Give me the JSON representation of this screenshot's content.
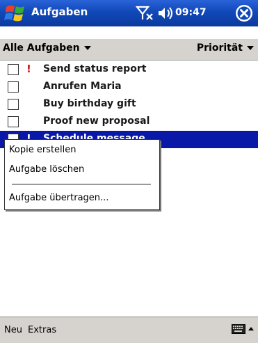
{
  "title_bar": {
    "app_title": "Aufgaben",
    "time": "09:47",
    "background": "#1148b8"
  },
  "filter_bar": {
    "category_label": "Alle Aufgaben",
    "sort_label": "Priorität"
  },
  "tasks": [
    {
      "label": "Send status report",
      "priority": "!",
      "selected": false
    },
    {
      "label": "Anrufen Maria",
      "priority": "",
      "selected": false
    },
    {
      "label": "Buy birthday gift",
      "priority": "",
      "selected": false
    },
    {
      "label": "Proof new proposal",
      "priority": "",
      "selected": false
    },
    {
      "label": "Schedule message",
      "priority": "!",
      "selected": true
    }
  ],
  "context_menu": {
    "items": [
      "Kopie erstellen",
      "Aufgabe löschen",
      "Aufgabe übertragen..."
    ]
  },
  "bottom_bar": {
    "new_label": "Neu",
    "tools_label": "Extras"
  },
  "colors": {
    "selection": "#0a18a8",
    "priority_high": "#d01010",
    "bar_gray": "#d6d3ce"
  }
}
